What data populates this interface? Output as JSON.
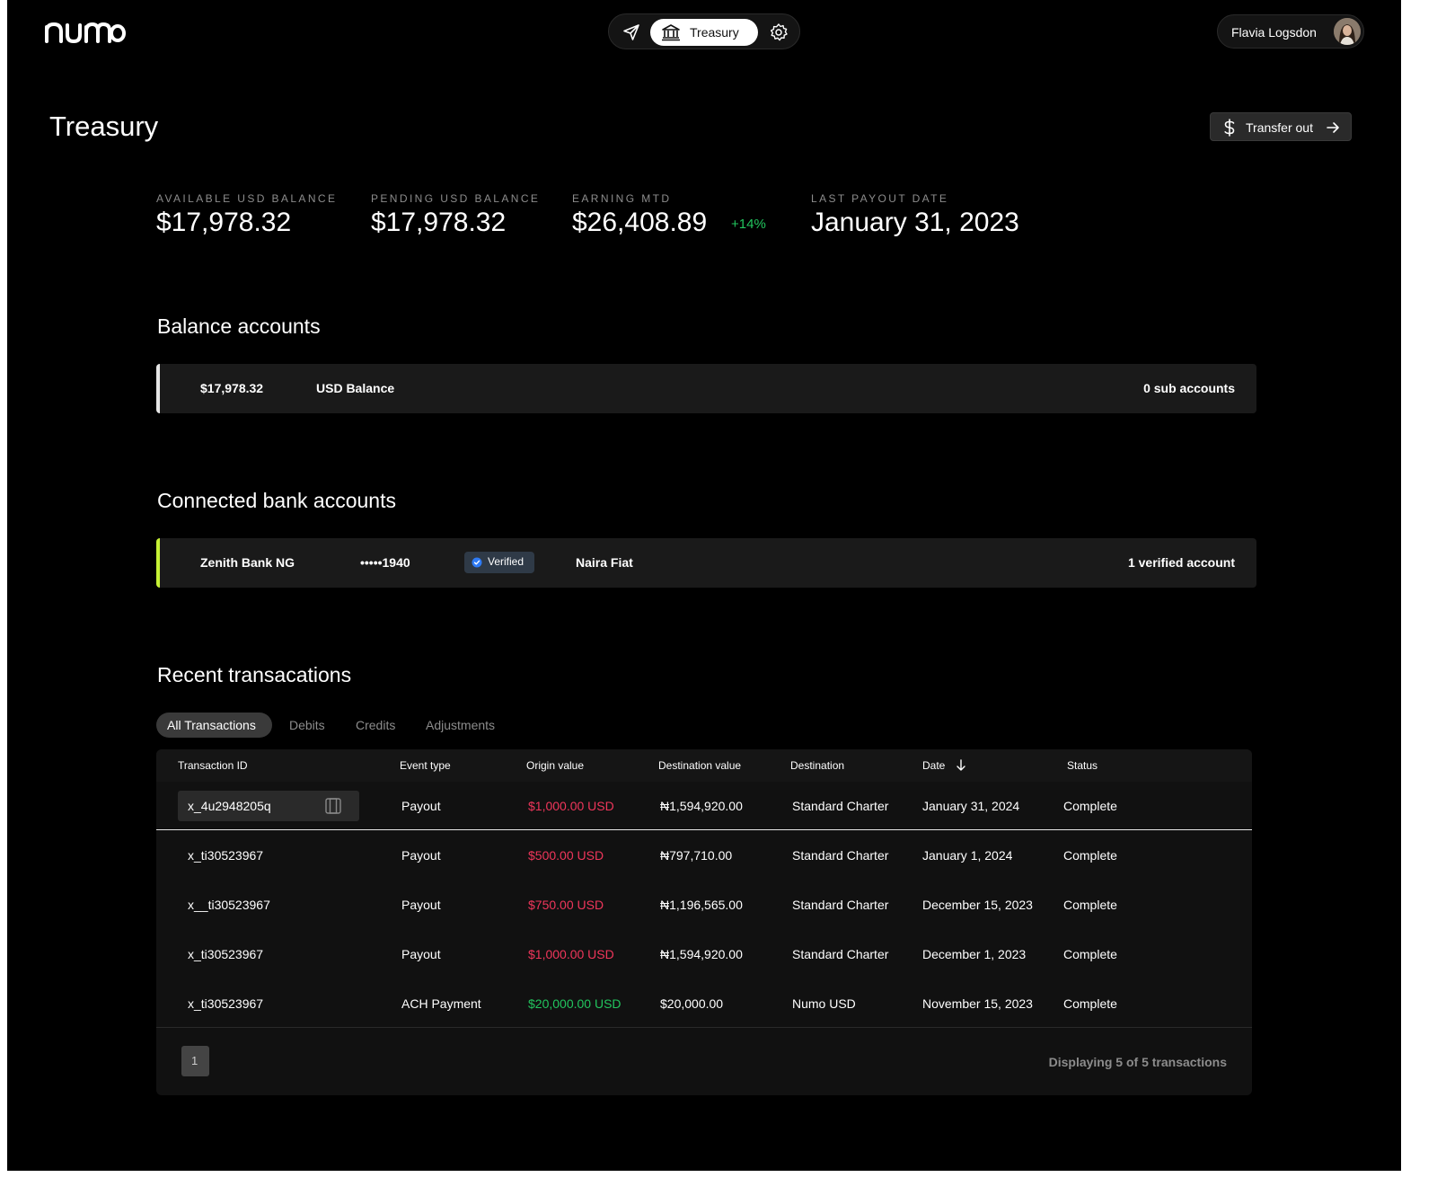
{
  "header": {
    "logo_text": "numo",
    "nav": {
      "active_tab_label": "Treasury"
    },
    "user": {
      "name": "Flavia Logsdon"
    }
  },
  "page": {
    "title": "Treasury",
    "transfer_button_label": "Transfer out"
  },
  "stats": [
    {
      "label": "AVAILABLE USD BALANCE",
      "value": "$17,978.32"
    },
    {
      "label": "PENDING USD BALANCE",
      "value": "$17,978.32"
    },
    {
      "label": "EARNING MTD",
      "value": "$26,408.89",
      "change": "+14%"
    },
    {
      "label": "LAST PAYOUT DATE",
      "value": "January 31, 2023"
    }
  ],
  "balance_accounts": {
    "title": "Balance accounts",
    "row": {
      "amount": "$17,978.32",
      "name": "USD Balance",
      "sub_accounts": "0 sub accounts"
    }
  },
  "bank_accounts": {
    "title": "Connected bank accounts",
    "row": {
      "bank": "Zenith Bank NG",
      "account_mask": "•••••1940",
      "badge": "Verified",
      "currency": "Naira Fiat",
      "count": "1 verified account"
    }
  },
  "transactions": {
    "title": "Recent transacations",
    "tabs": [
      "All Transactions",
      "Debits",
      "Credits",
      "Adjustments"
    ],
    "columns": [
      "Transaction ID",
      "Event type",
      "Origin value",
      "Destination value",
      "Destination",
      "Date",
      "Status"
    ],
    "rows": [
      {
        "id": "x_4u2948205q",
        "event": "Payout",
        "origin": "$1,000.00 USD",
        "dest_value": "₦1,594,920.00",
        "destination": "Standard Charter",
        "date": "January 31, 2024",
        "status": "Complete"
      },
      {
        "id": "x_ti30523967",
        "event": "Payout",
        "origin": "$500.00 USD",
        "dest_value": "₦797,710.00",
        "destination": "Standard Charter",
        "date": "January 1, 2024",
        "status": "Complete"
      },
      {
        "id": "x__ti30523967",
        "event": "Payout",
        "origin": "$750.00 USD",
        "dest_value": "₦1,196,565.00",
        "destination": "Standard Charter",
        "date": "December 15, 2023",
        "status": "Complete"
      },
      {
        "id": "x_ti30523967",
        "event": "Payout",
        "origin": "$1,000.00 USD",
        "dest_value": "₦1,594,920.00",
        "destination": "Standard Charter",
        "date": "December 1, 2023",
        "status": "Complete"
      },
      {
        "id": "x_ti30523967",
        "event": "ACH Payment",
        "origin": "$20,000.00 USD",
        "dest_value": "$20,000.00",
        "destination": "Numo USD",
        "date": "November 15, 2023",
        "status": "Complete"
      }
    ],
    "page_number": "1",
    "footer_text": "Displaying 5 of 5 transactions"
  },
  "colors": {
    "background": "#000000",
    "positive": "#22c55e",
    "negative": "#f0365b",
    "bank_accent": "#c6f135"
  },
  "icons": [
    "send-icon",
    "bank-icon",
    "gear-icon",
    "dollar-icon",
    "arrow-right-icon",
    "verified-check-icon",
    "copy-icon",
    "arrow-down-icon"
  ]
}
